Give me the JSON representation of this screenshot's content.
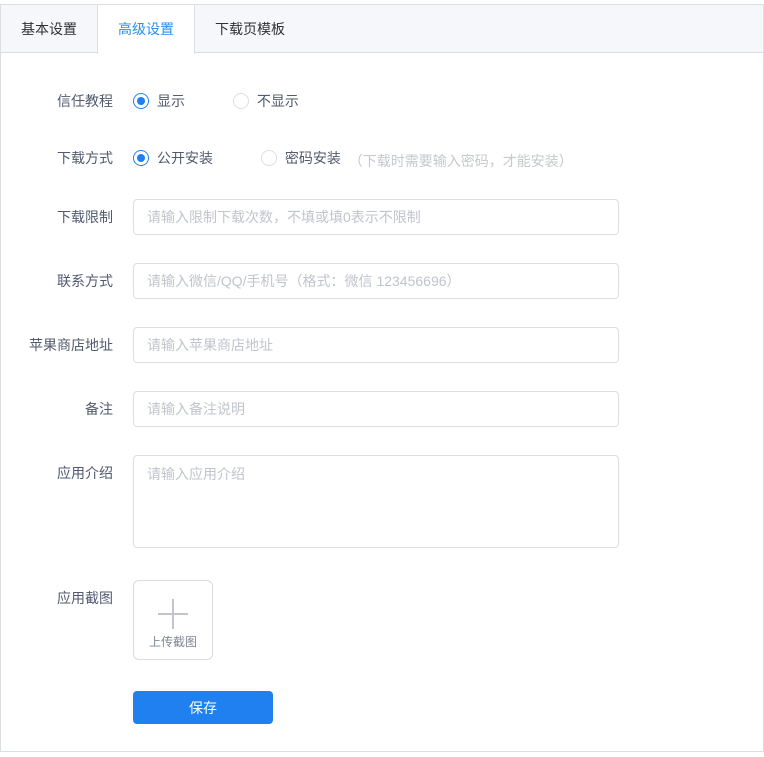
{
  "tabs": [
    {
      "label": "基本设置",
      "active": false
    },
    {
      "label": "高级设置",
      "active": true
    },
    {
      "label": "下载页模板",
      "active": false
    }
  ],
  "form": {
    "trust_tutorial": {
      "label": "信任教程",
      "options": [
        {
          "label": "显示",
          "checked": true
        },
        {
          "label": "不显示",
          "checked": false
        }
      ]
    },
    "download_method": {
      "label": "下载方式",
      "options": [
        {
          "label": "公开安装",
          "checked": true
        },
        {
          "label": "密码安装",
          "checked": false,
          "note": "（下载时需要输入密码，才能安装）"
        }
      ]
    },
    "download_limit": {
      "label": "下载限制",
      "placeholder": "请输入限制下载次数，不填或填0表示不限制",
      "value": ""
    },
    "contact": {
      "label": "联系方式",
      "placeholder": "请输入微信/QQ/手机号（格式：微信 123456696）",
      "value": ""
    },
    "apple_store": {
      "label": "苹果商店地址",
      "placeholder": "请输入苹果商店地址",
      "value": ""
    },
    "remark": {
      "label": "备注",
      "placeholder": "请输入备注说明",
      "value": ""
    },
    "app_intro": {
      "label": "应用介绍",
      "placeholder": "请输入应用介绍",
      "value": ""
    },
    "app_screenshot": {
      "label": "应用截图",
      "upload_text": "上传截图"
    },
    "save_label": "保存"
  },
  "colors": {
    "primary": "#2080f0",
    "active_tab_text": "#2d8cf0",
    "tab_header_bg": "#f5f7fa",
    "input_border": "#dcdee2",
    "placeholder": "#c0c4cc"
  }
}
